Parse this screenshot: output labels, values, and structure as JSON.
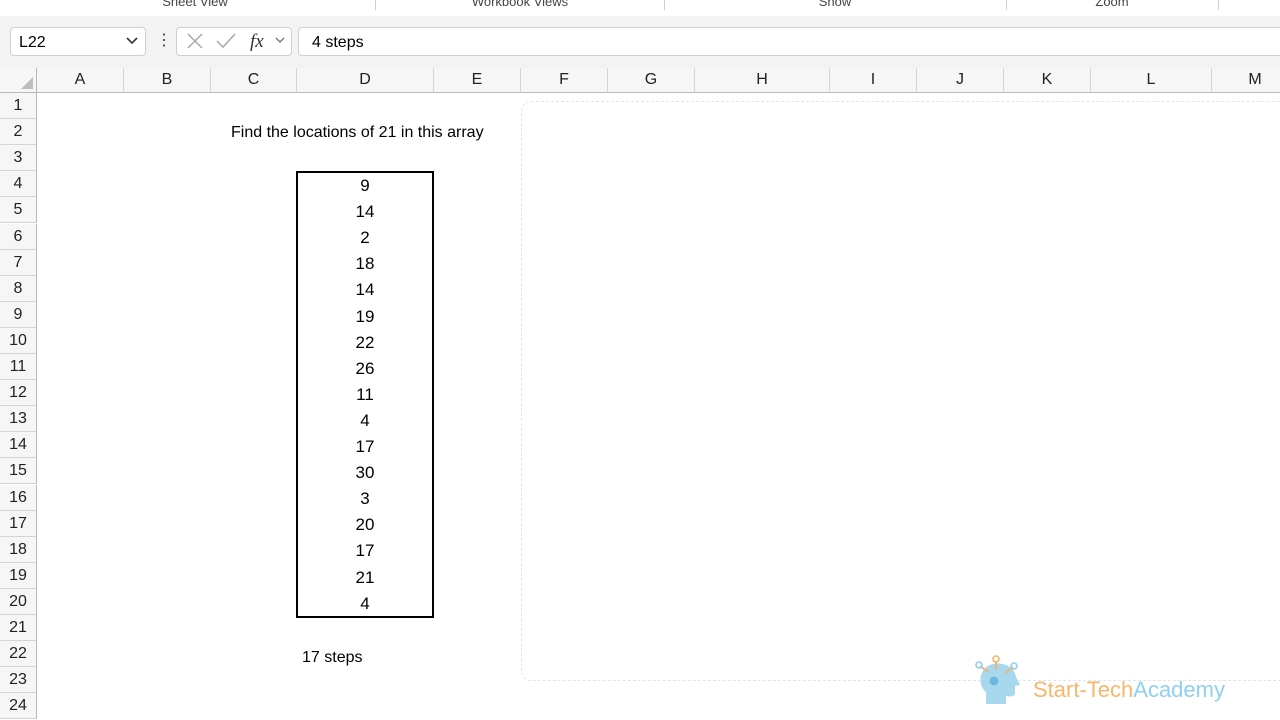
{
  "ribbon": {
    "groups": [
      "Sheet View",
      "Workbook Views",
      "Show",
      "Zoom"
    ]
  },
  "formula_bar": {
    "name_box": "L22",
    "formula": "4 steps"
  },
  "columns": [
    "A",
    "B",
    "C",
    "D",
    "E",
    "F",
    "G",
    "H",
    "I",
    "J",
    "K",
    "L",
    "M"
  ],
  "rows": [
    "1",
    "2",
    "3",
    "4",
    "5",
    "6",
    "7",
    "8",
    "9",
    "10",
    "11",
    "12",
    "13",
    "14",
    "15",
    "16",
    "17",
    "18",
    "19",
    "20",
    "21",
    "22",
    "23",
    "24"
  ],
  "sheet": {
    "prompt": "Find the locations of 21 in this array",
    "array_values": [
      "9",
      "14",
      "2",
      "18",
      "14",
      "19",
      "22",
      "26",
      "11",
      "4",
      "17",
      "30",
      "3",
      "20",
      "17",
      "21",
      "4"
    ],
    "steps_label": "17 steps"
  },
  "logo": {
    "part1": "Start-Tech",
    "part2": "Academy",
    "colors": {
      "start_tech": "#f5b86a",
      "academy": "#8fd0ee"
    }
  },
  "icons": {
    "namebox_dropdown": "chevron-down-icon",
    "more": "kebab-icon",
    "cancel": "close-icon",
    "enter": "check-icon",
    "insert_function": "fx-icon",
    "expand": "chevron-down-icon",
    "select_all": "select-all-triangle-icon"
  }
}
